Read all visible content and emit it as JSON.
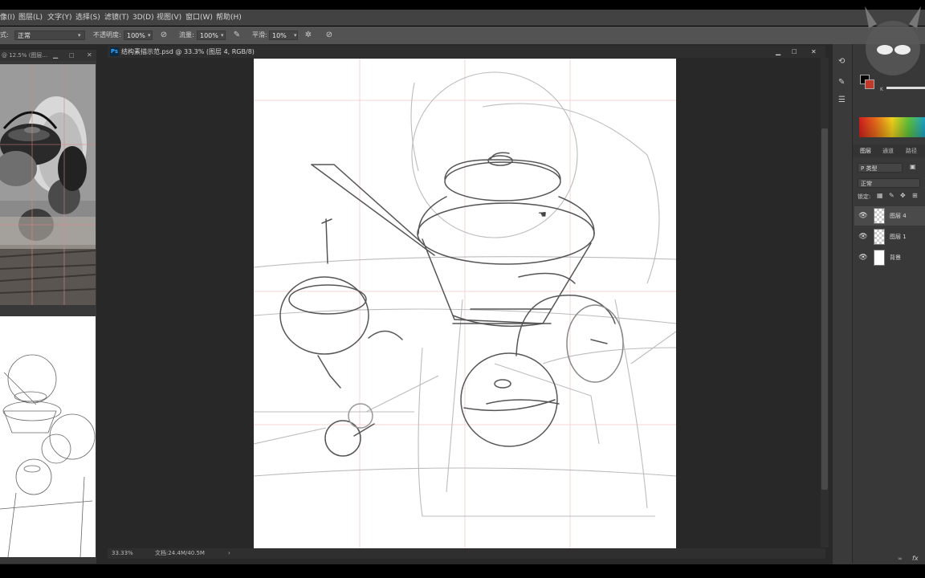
{
  "menu": {
    "items": [
      "像(I)",
      "图层(L)",
      "文字(Y)",
      "选择(S)",
      "滤镜(T)",
      "3D(D)",
      "视图(V)",
      "窗口(W)",
      "帮助(H)"
    ]
  },
  "options": {
    "mode_label": "式:",
    "mode_value": "正常",
    "opacity_label": "不透明度:",
    "opacity_value": "100%",
    "flow_label": "流量:",
    "flow_value": "100%",
    "smoothing_label": "平滑:",
    "smoothing_value": "10%"
  },
  "navigator": {
    "tab_label": "@ 12.5% (图层..."
  },
  "document": {
    "ps_badge": "Ps",
    "tab_title": "结构素描示范.psd @ 33.3% (图层 4, RGB/8)",
    "zoom": "33.33%",
    "doc_size": "文档:24.4M/40.5M"
  },
  "color": {
    "foreground": "#000000",
    "background": "#c0392b",
    "k_label": "K"
  },
  "layers_panel": {
    "tabs": [
      "图层",
      "通道",
      "路径"
    ],
    "filter_label": "P 类型",
    "blend_mode": "正常",
    "lock_label": "锁定:",
    "layers": [
      {
        "name": "图层 4",
        "selected": true
      },
      {
        "name": "图层 1",
        "selected": false
      },
      {
        "name": "背景",
        "selected": false
      }
    ],
    "fx_label": "fx"
  },
  "icons": [
    "close-icon",
    "minimize-icon",
    "maximize-icon",
    "eye-icon",
    "brush-icon",
    "gear-icon",
    "hand-cursor-icon"
  ]
}
